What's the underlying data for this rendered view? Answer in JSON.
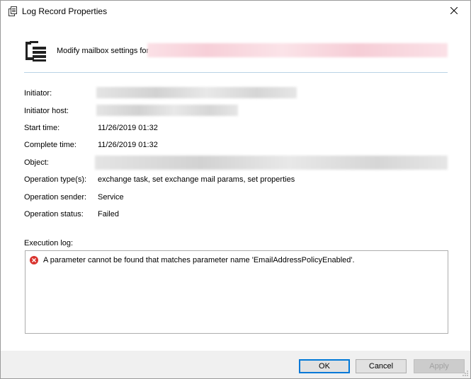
{
  "window": {
    "title": "Log Record Properties",
    "title_icon": "document-list-icon",
    "close_glyph": "✕"
  },
  "header": {
    "icon": "server-document-icon",
    "text": "Modify mailbox settings for"
  },
  "properties": {
    "initiator": {
      "label": "Initiator:"
    },
    "initiator_host": {
      "label": "Initiator host:"
    },
    "start_time": {
      "label": "Start time:",
      "value": "11/26/2019 01:32"
    },
    "complete_time": {
      "label": "Complete time:",
      "value": "11/26/2019 01:32"
    },
    "object": {
      "label": "Object:"
    },
    "operation_types": {
      "label": "Operation type(s):",
      "value": "exchange task, set exchange mail params, set properties"
    },
    "operation_sender": {
      "label": "Operation sender:",
      "value": "Service"
    },
    "operation_status": {
      "label": "Operation status:",
      "value": "Failed"
    }
  },
  "execution_log": {
    "label": "Execution log:",
    "entries": [
      {
        "icon": "error-icon",
        "text": "A parameter cannot be found that matches parameter name 'EmailAddressPolicyEnabled'."
      }
    ]
  },
  "buttons": {
    "ok": "OK",
    "cancel": "Cancel",
    "apply": "Apply"
  },
  "colors": {
    "accent": "#0078d7",
    "error": "#d9342f",
    "separator": "#b9d3e6"
  }
}
